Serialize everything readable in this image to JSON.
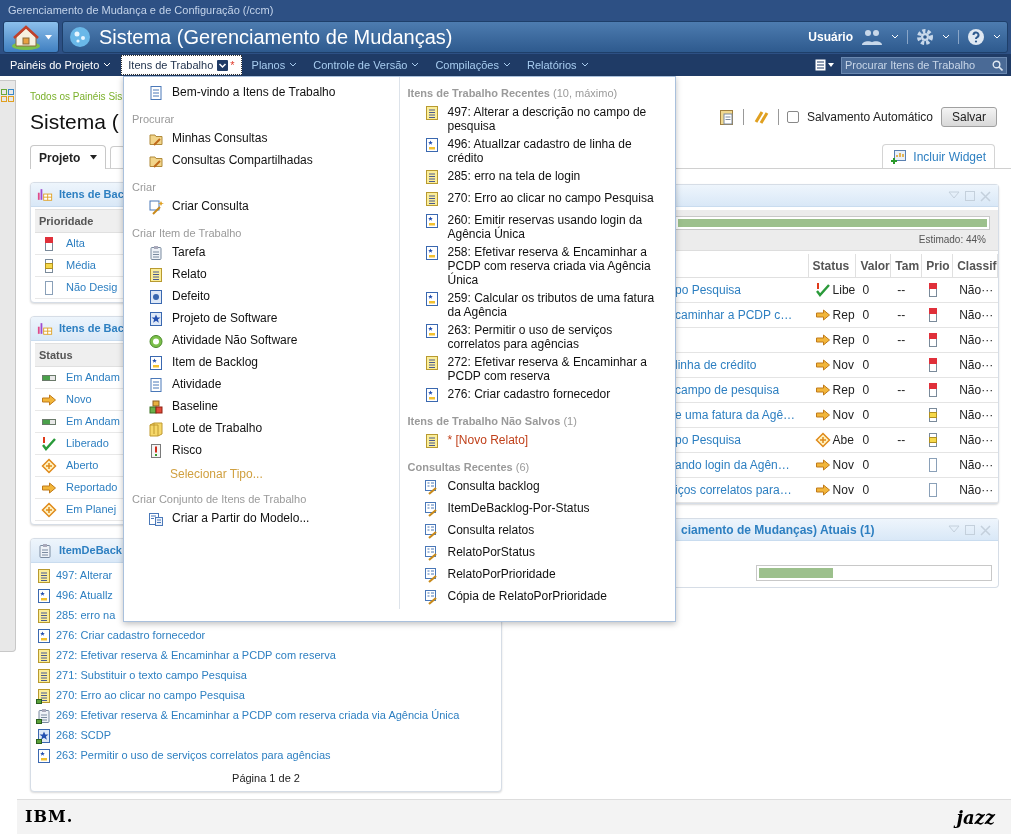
{
  "app_title": "Gerenciamento de Mudança e de Configuração (/ccm)",
  "banner": {
    "title": "Sistema (Gerenciamento de Mudanças)",
    "user": "Usuário"
  },
  "nav": {
    "items": [
      {
        "label": "Painéis do Projeto",
        "current": true,
        "selected": false
      },
      {
        "label": "Itens de Trabalho",
        "current": false,
        "selected": true,
        "marker": "*"
      },
      {
        "label": "Planos",
        "current": false,
        "selected": false
      },
      {
        "label": "Controle de Versão",
        "current": false,
        "selected": false
      },
      {
        "label": "Compilações",
        "current": false,
        "selected": false
      },
      {
        "label": "Relatórios",
        "current": false,
        "selected": false
      }
    ],
    "search": {
      "placeholder": "Procurar Itens de Trabalho"
    }
  },
  "breadcrumb": "Todos os Painéis Sis",
  "page_title": "Sistema (",
  "tabs": [
    {
      "label": "Projeto",
      "selected": true
    }
  ],
  "toolbar": {
    "autosave": {
      "label": "Salvamento Automático",
      "checked": false
    },
    "save": "Salvar",
    "add_widget": "Incluir Widget"
  },
  "widgets_left": [
    {
      "title": "Itens de Bac",
      "column": "Prioridade",
      "rows": [
        {
          "label": "Alta",
          "kind": "high"
        },
        {
          "label": "Média",
          "kind": "medium"
        },
        {
          "label": "Não Desig",
          "kind": "none"
        }
      ]
    },
    {
      "title": "Itens de Bac",
      "column": "Status",
      "rows": [
        {
          "label": "Em Andam",
          "kind": "progress"
        },
        {
          "label": "Novo",
          "kind": "arrow"
        },
        {
          "label": "Em Andam",
          "kind": "progress"
        },
        {
          "label": "Liberado",
          "kind": "done"
        },
        {
          "label": "Aberto",
          "kind": "open"
        },
        {
          "label": "Reportado",
          "kind": "arrow"
        },
        {
          "label": "Em Planej",
          "kind": "open"
        }
      ]
    }
  ],
  "backlog_widget": {
    "title": "ItemDeBack",
    "items": [
      {
        "label": "497: Alterar",
        "kind": "relato",
        "overlay": false
      },
      {
        "label": "496: Atuallz",
        "kind": "backlog",
        "overlay": false
      },
      {
        "label": "285: erro na",
        "kind": "relato",
        "overlay": false
      },
      {
        "label": "276: Criar cadastro fornecedor",
        "kind": "backlog",
        "overlay": false
      },
      {
        "label": "272: Efetivar reserva & Encaminhar a PCDP com reserva",
        "kind": "relato",
        "overlay": false
      },
      {
        "label": "271: Substituir o texto campo Pesquisa",
        "kind": "relato",
        "overlay": false
      },
      {
        "label": "270: Erro ao clicar no campo Pesquisa",
        "kind": "relato",
        "overlay": true
      },
      {
        "label": "269: Efetivar reserva & Encaminhar a PCDP com reserva criada via Agência Única",
        "kind": "task",
        "overlay": true
      },
      {
        "label": "268: SCDP",
        "kind": "project",
        "overlay": true
      },
      {
        "label": "263: Permitir o uso de serviços correlatos para agências",
        "kind": "backlog",
        "overlay": false
      }
    ],
    "pager": "Página 1 de 2"
  },
  "progress_widget": {
    "progress": {
      "level": 1,
      "label": "Estimado: 44%"
    },
    "columns": [
      "Status",
      "Valor",
      "Tam",
      "Prio",
      "Classif"
    ],
    "rows": [
      {
        "summary": "po Pesquisa",
        "status": {
          "kind": "done",
          "label": "Libe"
        },
        "value": "0",
        "tam": "--",
        "priority": {
          "kind": "high"
        },
        "classif": "Não···"
      },
      {
        "summary": "caminhar a PCDP c…",
        "status": {
          "kind": "arrow",
          "label": "Rep"
        },
        "value": "0",
        "tam": "--",
        "priority": {
          "kind": "high"
        },
        "classif": "Não···"
      },
      {
        "status": {
          "kind": "arrow",
          "label": "Rep"
        },
        "value": "0",
        "tam": "--",
        "priority": {
          "kind": "high"
        },
        "classif": "Não···"
      },
      {
        "summary": "linha de crédito",
        "status": {
          "kind": "arrow",
          "label": "Nov"
        },
        "value": "0",
        "priority": {
          "kind": "high"
        },
        "classif": "Não···"
      },
      {
        "summary": "campo de pesquisa",
        "status": {
          "kind": "arrow",
          "label": "Rep"
        },
        "value": "0",
        "tam": "--",
        "priority": {
          "kind": "high"
        },
        "classif": "Não···"
      },
      {
        "summary": "e uma fatura da Agê…",
        "status": {
          "kind": "arrow",
          "label": "Nov"
        },
        "value": "0",
        "priority": {
          "kind": "medium"
        },
        "classif": "Não···"
      },
      {
        "summary": "po Pesquisa",
        "status": {
          "kind": "open",
          "label": "Abe"
        },
        "value": "0",
        "tam": "--",
        "priority": {
          "kind": "medium"
        },
        "classif": "Não···"
      },
      {
        "summary": "ando login da Agên…",
        "status": {
          "kind": "arrow",
          "label": "Nov"
        },
        "value": "0",
        "priority": {
          "kind": "none"
        },
        "classif": "Não···"
      },
      {
        "summary": "iços correlatos para…",
        "status": {
          "kind": "arrow",
          "label": "Nov"
        },
        "value": "0",
        "priority": {
          "kind": "none"
        },
        "classif": "Não···"
      }
    ]
  },
  "current_widget": {
    "title": "ciamento de Mudanças) Atuais (1)",
    "progress": {
      "level": 0.32
    }
  },
  "menu": {
    "columns": [
      [
        {
          "kind": "list",
          "label": "Bem-vindo a Itens de Trabalho"
        },
        {
          "kind": "heading",
          "label": "Procurar"
        },
        {
          "kind": "query",
          "label": "Minhas Consultas"
        },
        {
          "kind": "query",
          "label": "Consultas Compartilhadas"
        },
        {
          "kind": "heading",
          "label": "Criar"
        },
        {
          "kind": "new-query",
          "label": "Criar Consulta"
        },
        {
          "kind": "heading",
          "label": "Criar Item de Trabalho"
        },
        {
          "kind": "task",
          "label": "Tarefa"
        },
        {
          "kind": "relato",
          "label": "Relato"
        },
        {
          "kind": "defect",
          "label": "Defeito"
        },
        {
          "kind": "project",
          "label": "Projeto de Software"
        },
        {
          "kind": "ring",
          "label": "Atividade Não Software"
        },
        {
          "kind": "backlog",
          "label": "Item de Backlog"
        },
        {
          "kind": "list",
          "label": "Atividade"
        },
        {
          "kind": "blocks",
          "label": "Baseline"
        },
        {
          "kind": "box",
          "label": "Lote de Trabalho"
        },
        {
          "kind": "risk",
          "label": "Risco"
        },
        {
          "kind": "link",
          "label": "Selecionar Tipo..."
        },
        {
          "kind": "heading",
          "label": "Criar Conjunto de Itens de Trabalho"
        },
        {
          "kind": "template",
          "label": "Criar a Partir do Modelo..."
        }
      ],
      [
        {
          "kind": "heading",
          "label": "Itens de Trabalho Recentes",
          "count": "(10, máximo)"
        },
        {
          "kind": "relato",
          "label": "497: Alterar a descrição no campo de pesquisa"
        },
        {
          "kind": "backlog",
          "label": "496: Atuallzar cadastro de linha de crédito"
        },
        {
          "kind": "relato",
          "label": "285: erro na tela de login"
        },
        {
          "kind": "relato",
          "label": "270: Erro ao clicar no campo Pesquisa"
        },
        {
          "kind": "backlog",
          "label": "260: Emitir reservas usando login da Agência Única"
        },
        {
          "kind": "backlog",
          "label": "258: Efetivar reserva & Encaminhar a PCDP com reserva criada via Agência Única"
        },
        {
          "kind": "backlog",
          "label": "259: Calcular os tributos de uma fatura da Agência"
        },
        {
          "kind": "backlog",
          "label": "263: Permitir o uso de serviços correlatos para agências"
        },
        {
          "kind": "relato",
          "label": "272: Efetivar reserva & Encaminhar a PCDP com reserva"
        },
        {
          "kind": "backlog",
          "label": "276: Criar cadastro fornecedor"
        },
        {
          "kind": "heading",
          "label": "Itens de Trabalho Não Salvos",
          "count": "(1)"
        },
        {
          "kind": "unsaved",
          "label": "* [Novo Relato]"
        },
        {
          "kind": "heading",
          "label": "Consultas Recentes",
          "count": "(6)"
        },
        {
          "kind": "saved-query",
          "label": "Consulta backlog"
        },
        {
          "kind": "saved-query",
          "label": "ItemDeBacklog-Por-Status"
        },
        {
          "kind": "saved-query",
          "label": "Consulta relatos"
        },
        {
          "kind": "saved-query",
          "label": "RelatoPorStatus"
        },
        {
          "kind": "saved-query",
          "label": "RelatoPorPrioridade"
        },
        {
          "kind": "saved-query",
          "label": "Cópia de RelatoPorPrioridade"
        }
      ]
    ]
  },
  "footer": {
    "left_logo": "IBM.",
    "right_logo": "jazz"
  }
}
